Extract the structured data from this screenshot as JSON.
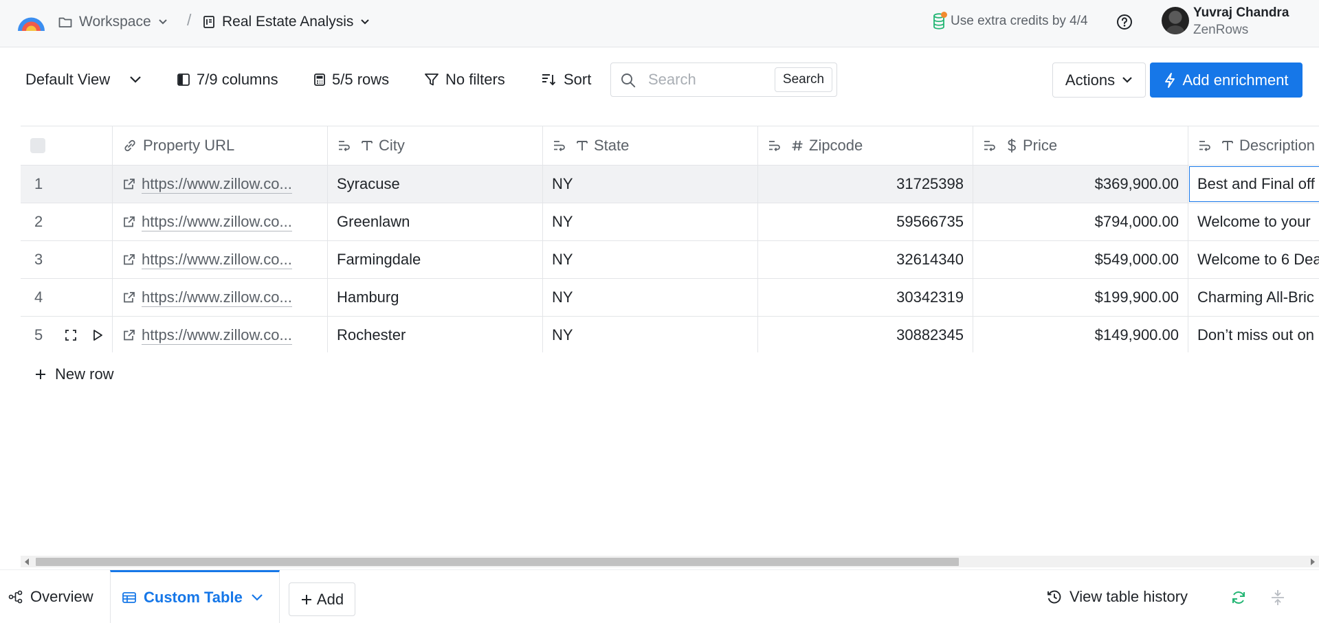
{
  "header": {
    "workspace_label": "Workspace",
    "separator": "/",
    "project_label": "Real Estate Analysis",
    "credits_text": "Use extra credits by 4/4",
    "user_name": "Yuvraj Chandra",
    "user_org": "ZenRows"
  },
  "toolbar": {
    "view_label": "Default View",
    "columns_label": "7/9 columns",
    "rows_label": "5/5 rows",
    "filters_label": "No filters",
    "sort_label": "Sort",
    "search_placeholder": "Search",
    "search_button": "Search",
    "actions_label": "Actions",
    "add_enrichment_label": "Add enrichment"
  },
  "table": {
    "columns": [
      "Property URL",
      "City",
      "State",
      "Zipcode",
      "Price",
      "Description"
    ],
    "rows": [
      {
        "num": "1",
        "url": "https://www.zillow.co...",
        "city": "Syracuse",
        "state": "NY",
        "zip": "31725398",
        "price": "$369,900.00",
        "desc": "Best and Final off"
      },
      {
        "num": "2",
        "url": "https://www.zillow.co...",
        "city": "Greenlawn",
        "state": "NY",
        "zip": "59566735",
        "price": "$794,000.00",
        "desc": "Welcome to your"
      },
      {
        "num": "3",
        "url": "https://www.zillow.co...",
        "city": "Farmingdale",
        "state": "NY",
        "zip": "32614340",
        "price": "$549,000.00",
        "desc": "Welcome to 6 Dea"
      },
      {
        "num": "4",
        "url": "https://www.zillow.co...",
        "city": "Hamburg",
        "state": "NY",
        "zip": "30342319",
        "price": "$199,900.00",
        "desc": "Charming All-Bric"
      },
      {
        "num": "5",
        "url": "https://www.zillow.co...",
        "city": "Rochester",
        "state": "NY",
        "zip": "30882345",
        "price": "$149,900.00",
        "desc": "Don’t miss out on"
      }
    ],
    "new_row_label": "New row"
  },
  "footer": {
    "overview_label": "Overview",
    "tab_label": "Custom Table",
    "add_label": "Add",
    "history_label": "View table history"
  },
  "colors": {
    "accent": "#1677e8",
    "refresh": "#22b573",
    "credits_dot": "#f28b30"
  },
  "icons": [
    "logo-icon",
    "folder-icon",
    "document-icon",
    "database-icon",
    "help-icon",
    "columns-icon",
    "calculator-icon",
    "filter-icon",
    "sort-icon",
    "search-icon",
    "bolt-icon",
    "link-icon",
    "text-type-icon",
    "hash-icon",
    "dollar-icon",
    "wrap-icon",
    "external-link-icon",
    "expand-icon",
    "play-icon",
    "plus-icon",
    "flow-icon",
    "table-icon",
    "history-icon",
    "refresh-icon",
    "collapse-icon"
  ]
}
